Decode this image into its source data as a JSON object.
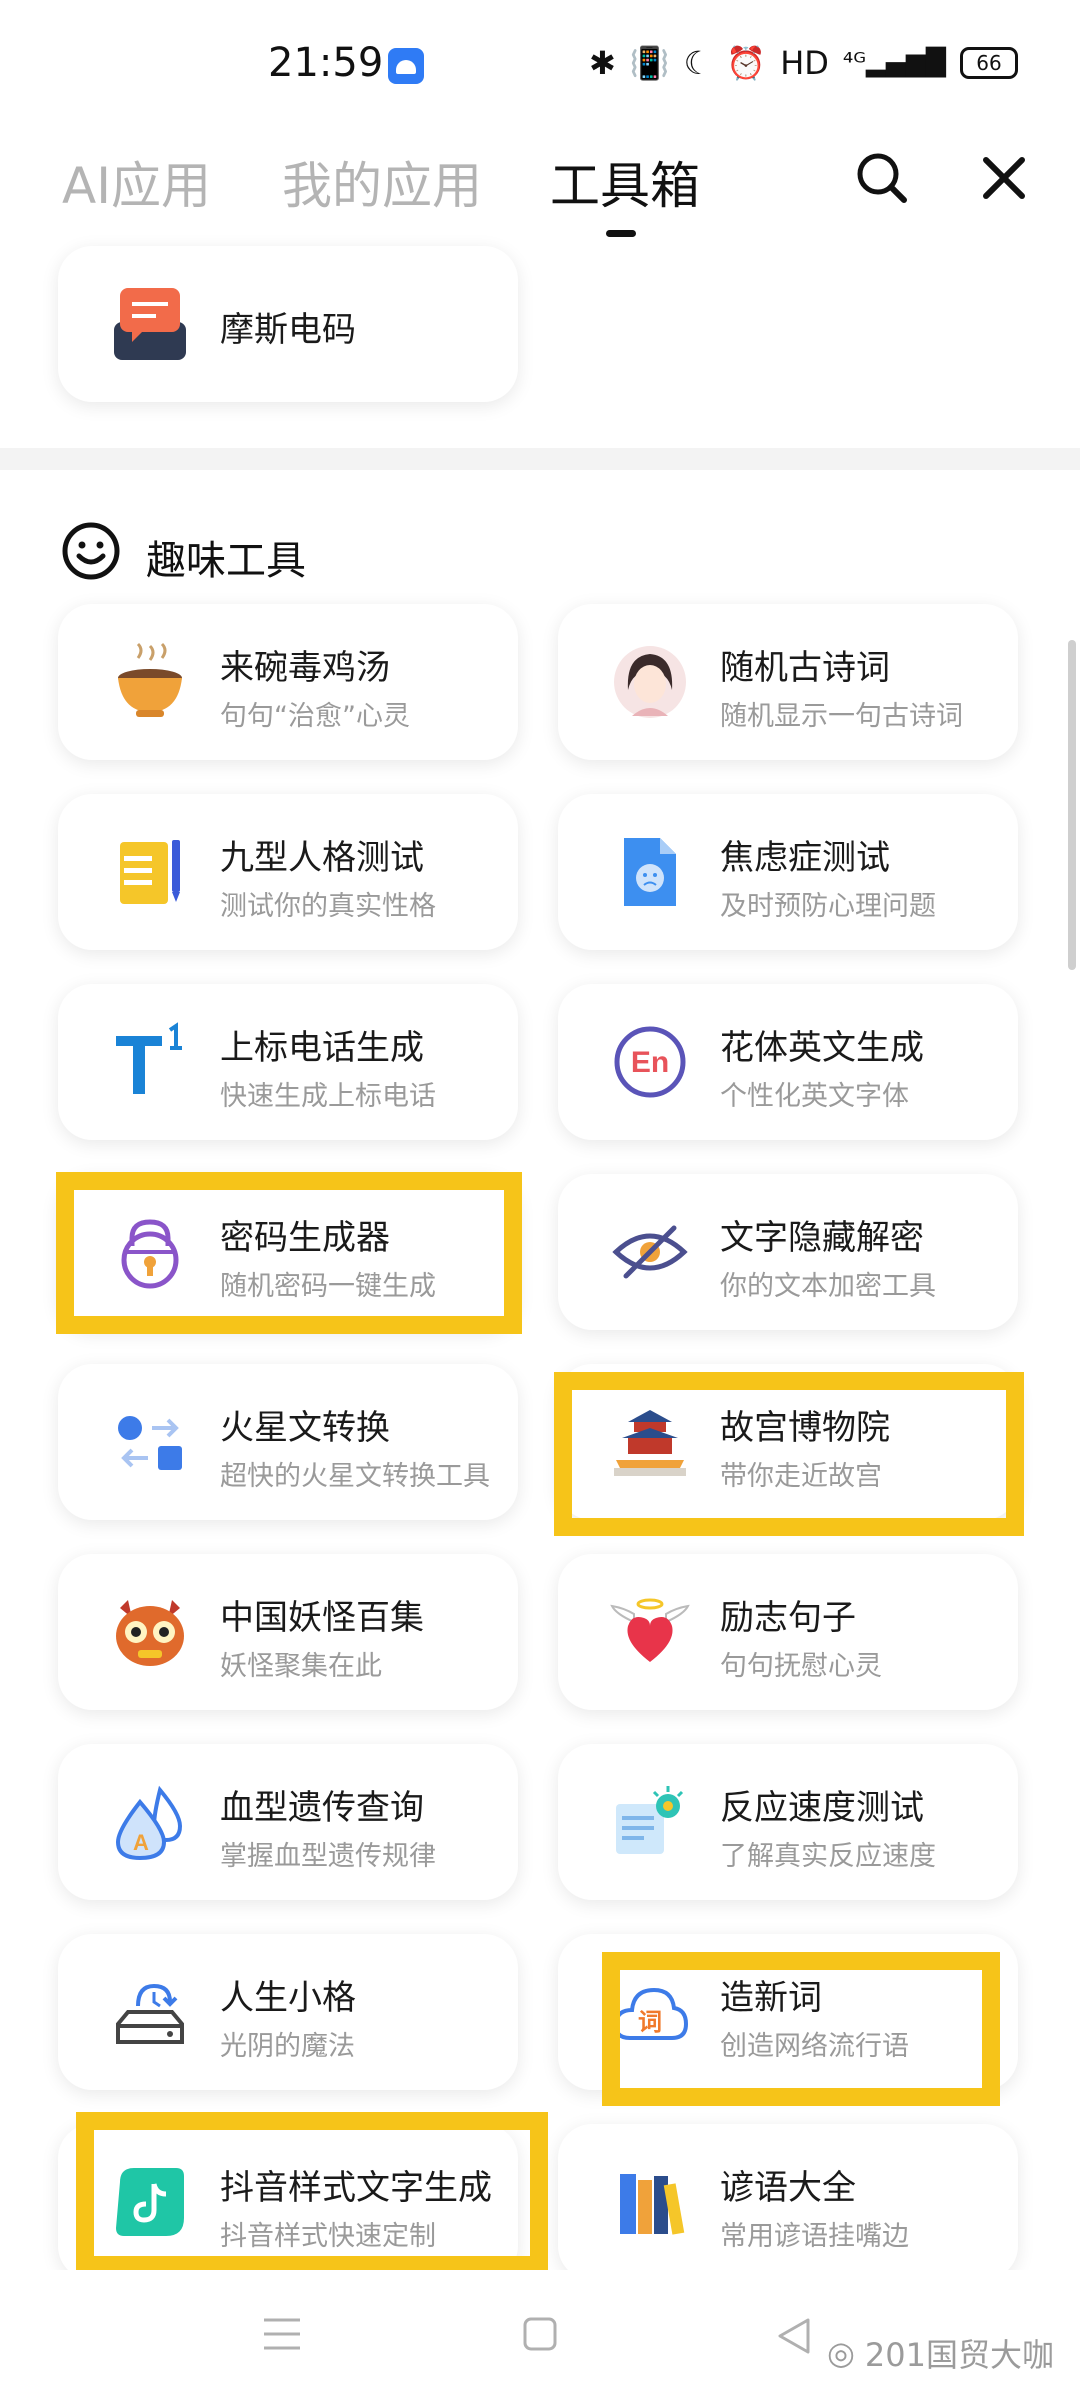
{
  "status_bar": {
    "time": "21:59",
    "network": "HD",
    "battery": "66"
  },
  "header": {
    "tabs": [
      {
        "label": "AI应用",
        "active": false
      },
      {
        "label": "我的应用",
        "active": false
      },
      {
        "label": "工具箱",
        "active": true
      }
    ],
    "search_icon": "search-icon",
    "close_icon": "close-icon"
  },
  "top_card": {
    "title": "摩斯电码"
  },
  "section": {
    "title": "趣味工具"
  },
  "tools": [
    {
      "title": "来碗毒鸡汤",
      "subtitle": "句句“治愈”心灵",
      "icon": "soup-bowl-icon"
    },
    {
      "title": "随机古诗词",
      "subtitle": "随机显示一句古诗词",
      "icon": "poet-avatar-icon"
    },
    {
      "title": "九型人格测试",
      "subtitle": "测试你的真实性格",
      "icon": "notebook-icon"
    },
    {
      "title": "焦虑症测试",
      "subtitle": "及时预防心理问题",
      "icon": "sad-document-icon"
    },
    {
      "title": "上标电话生成",
      "subtitle": "快速生成上标电话",
      "icon": "superscript-icon"
    },
    {
      "title": "花体英文生成",
      "subtitle": "个性化英文字体",
      "icon": "en-circle-icon"
    },
    {
      "title": "密码生成器",
      "subtitle": "随机密码一键生成",
      "icon": "lock-icon"
    },
    {
      "title": "文字隐藏解密",
      "subtitle": "你的文本加密工具",
      "icon": "hidden-eye-icon"
    },
    {
      "title": "火星文转换",
      "subtitle": "超快的火星文转换工具",
      "icon": "convert-icon"
    },
    {
      "title": "故宫博物院",
      "subtitle": "带你走近故宫",
      "icon": "palace-icon"
    },
    {
      "title": "中国妖怪百集",
      "subtitle": "妖怪聚集在此",
      "icon": "monster-icon"
    },
    {
      "title": "励志句子",
      "subtitle": "句句抚慰心灵",
      "icon": "winged-heart-icon"
    },
    {
      "title": "血型遗传查询",
      "subtitle": "掌握血型遗传规律",
      "icon": "blood-drop-icon"
    },
    {
      "title": "反应速度测试",
      "subtitle": "了解真实反应速度",
      "icon": "reaction-icon"
    },
    {
      "title": "人生小格",
      "subtitle": "光阴的魔法",
      "icon": "time-drive-icon"
    },
    {
      "title": "造新词",
      "subtitle": "创造网络流行语",
      "icon": "word-cloud-icon"
    },
    {
      "title": "抖音样式文字生成",
      "subtitle": "抖音样式快速定制",
      "icon": "tiktok-icon"
    },
    {
      "title": "谚语大全",
      "subtitle": "常用谚语挂嘴边",
      "icon": "books-icon"
    }
  ],
  "highlight_color": "#f6c419",
  "watermark": {
    "text": "201国贸大咖"
  }
}
